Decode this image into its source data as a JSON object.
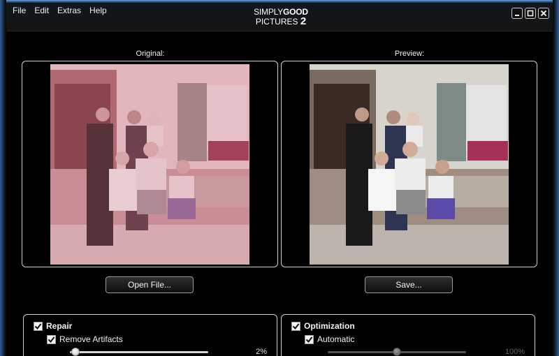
{
  "menu": [
    "File",
    "Edit",
    "Extras",
    "Help"
  ],
  "logo": {
    "line1_light": "SIMPLY",
    "line1_bold": "GOOD",
    "line2": "PICTURES",
    "line2_num": "2"
  },
  "window_buttons": [
    "minimize-icon",
    "maximize-icon",
    "close-icon"
  ],
  "original": {
    "label": "Original:"
  },
  "preview": {
    "label": "Preview:"
  },
  "buttons": {
    "open": "Open File...",
    "save": "Save..."
  },
  "repair": {
    "title": "Repair",
    "checked": true,
    "remove_artifacts": {
      "label": "Remove Artifacts",
      "checked": true
    },
    "slider_value_text": "2%",
    "slider_fraction": 0.02
  },
  "optimization": {
    "title": "Optimization",
    "checked": true,
    "automatic": {
      "label": "Automatic",
      "checked": true
    },
    "slider_value_text": "100%",
    "slider_fraction": 0.5,
    "slider_disabled": true
  },
  "colors": {
    "accent": "#2d5f96",
    "panel_border": "#d0d0d0",
    "background": "#000000"
  }
}
